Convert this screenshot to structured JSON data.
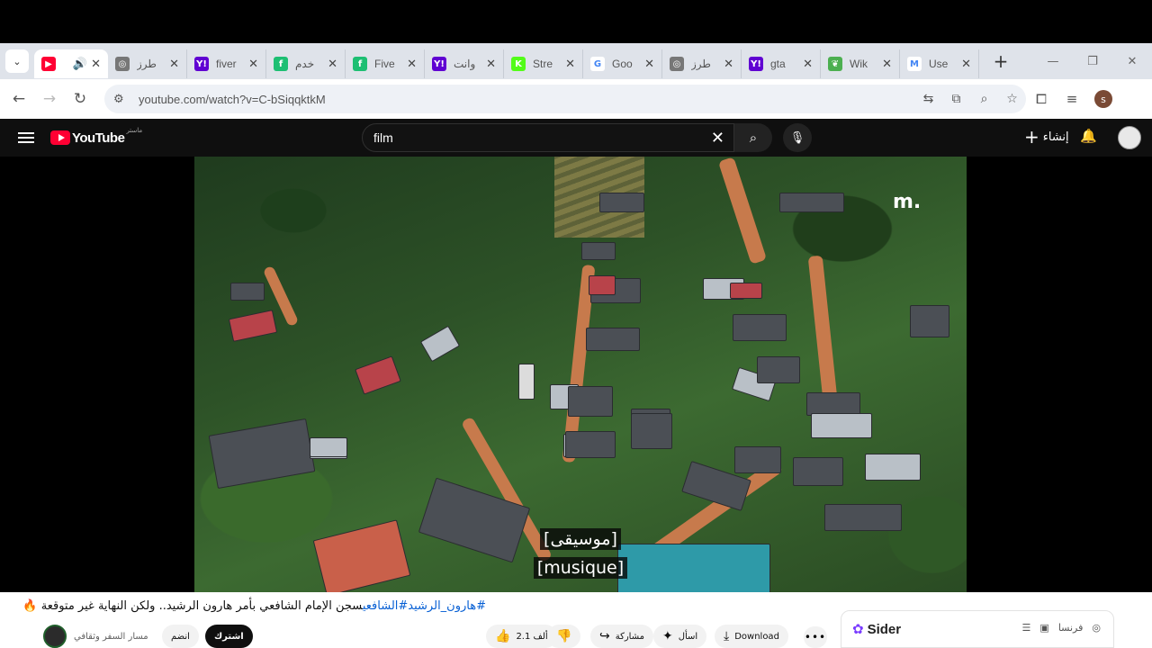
{
  "browser": {
    "tabs": [
      {
        "title": "",
        "icon": "youtube-icon",
        "color": "#ff0033",
        "glyph": "▶",
        "active": true,
        "sound": "🔊"
      },
      {
        "title": "طرز",
        "icon": "chatgpt-icon",
        "color": "#777777",
        "glyph": "◎"
      },
      {
        "title": "fiver",
        "icon": "yahoo-icon",
        "color": "#6001d2",
        "glyph": "Y!"
      },
      {
        "title": "خدم",
        "icon": "fiverr-icon",
        "color": "#1dbf73",
        "glyph": "f"
      },
      {
        "title": "Five",
        "icon": "fiverr-icon",
        "color": "#1dbf73",
        "glyph": "f"
      },
      {
        "title": "وانت",
        "icon": "yahoo-icon",
        "color": "#6001d2",
        "glyph": "Y!"
      },
      {
        "title": "Stre",
        "icon": "kick-icon",
        "color": "#53fc18",
        "glyph": "K"
      },
      {
        "title": "Goo",
        "icon": "google-icon",
        "color": "#ffffff",
        "glyph": "G"
      },
      {
        "title": "طرز",
        "icon": "chatgpt-icon",
        "color": "#777777",
        "glyph": "◎"
      },
      {
        "title": "gta",
        "icon": "yahoo-icon",
        "color": "#6001d2",
        "glyph": "Y!"
      },
      {
        "title": "Wik",
        "icon": "leaf-icon",
        "color": "#4caf50",
        "glyph": "❦"
      },
      {
        "title": "Use",
        "icon": "gmail-icon",
        "color": "#ffffff",
        "glyph": "M"
      }
    ],
    "url": "youtube.com/watch?v=C-bSiqqktkM",
    "profile_initial": "s"
  },
  "youtube": {
    "logo_text": "YouTube",
    "logo_sup": "ماستر",
    "search_query": "film",
    "create_label": "إنشاء"
  },
  "video": {
    "watermark": "m.",
    "caption_line1": "[موسيقى]",
    "caption_line2": "[musique]"
  },
  "below": {
    "title_tags": "#هارون_الرشيد#الشافعي",
    "title_text": "سجن الإمام الشافعي بأمر هارون الرشيد.. ولكن النهاية غير متوقعة 🔥",
    "channel_name": "مسار السفر وثقافي",
    "subscribe_label": "اشترك",
    "join_label": "انضم",
    "likes": "2.1 ألف",
    "share_label": "مشاركة",
    "ask_label": "اسأل",
    "download_label": "Download"
  },
  "sider": {
    "name": "Sider",
    "lang": "فرنسا"
  }
}
